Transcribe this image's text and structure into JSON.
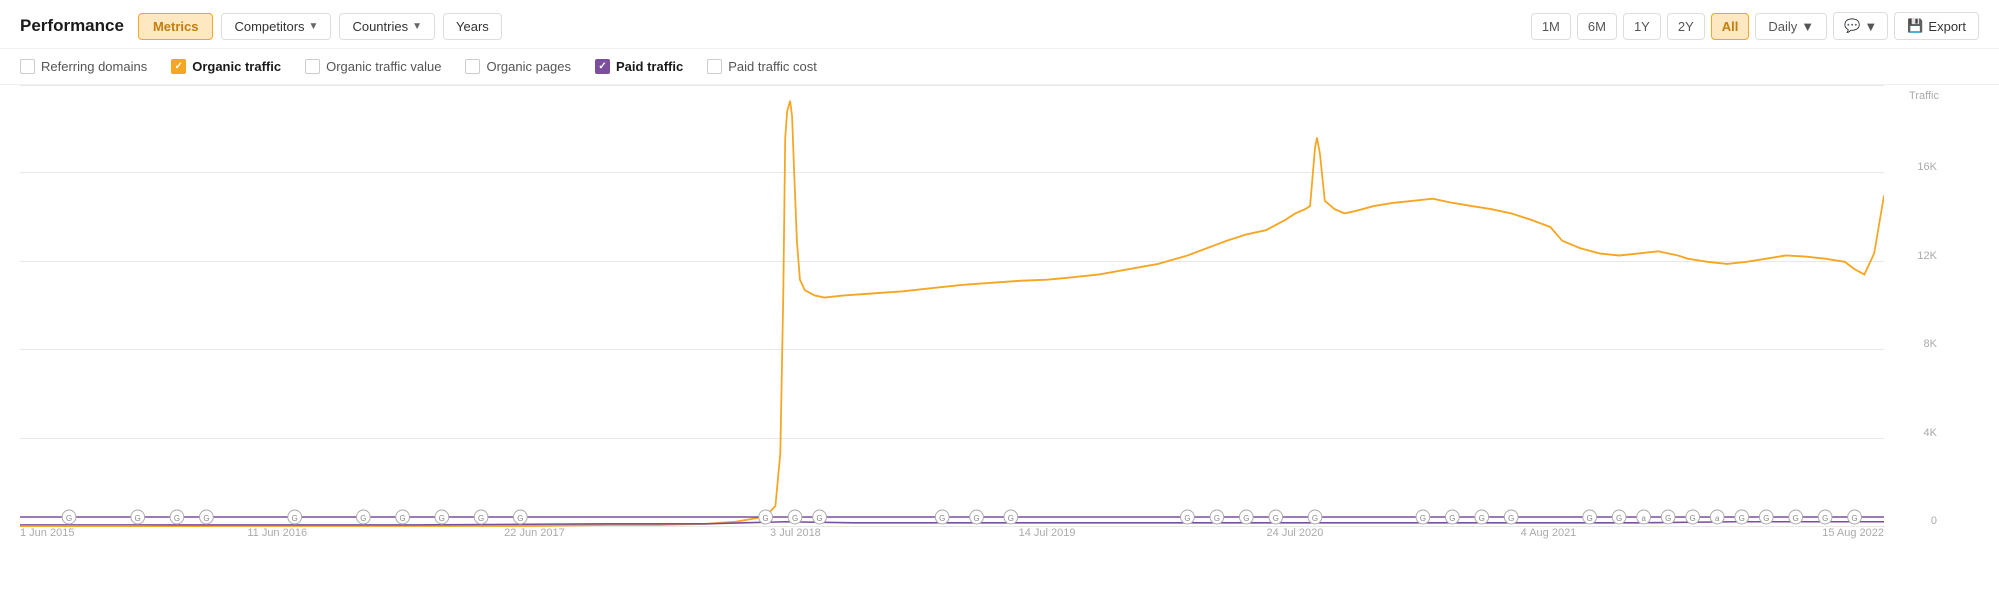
{
  "header": {
    "title": "Performance",
    "buttons": {
      "metrics": "Metrics",
      "competitors": "Competitors",
      "countries": "Countries",
      "years": "Years"
    },
    "time_ranges": [
      "1M",
      "6M",
      "1Y",
      "2Y",
      "All"
    ],
    "active_time_range": "All",
    "interval": "Daily",
    "export_label": "Export"
  },
  "metrics": [
    {
      "id": "referring_domains",
      "label": "Referring domains",
      "checked": false,
      "color": "none"
    },
    {
      "id": "organic_traffic",
      "label": "Organic traffic",
      "checked": true,
      "color": "orange"
    },
    {
      "id": "organic_traffic_value",
      "label": "Organic traffic value",
      "checked": false,
      "color": "none"
    },
    {
      "id": "organic_pages",
      "label": "Organic pages",
      "checked": false,
      "color": "none"
    },
    {
      "id": "paid_traffic",
      "label": "Paid traffic",
      "checked": true,
      "color": "purple"
    },
    {
      "id": "paid_traffic_cost",
      "label": "Paid traffic cost",
      "checked": false,
      "color": "none"
    }
  ],
  "chart": {
    "y_axis_label": "Traffic",
    "y_labels": [
      "0",
      "4K",
      "8K",
      "12K",
      "16K",
      ""
    ],
    "x_labels": [
      "1 Jun 2015",
      "11 Jun 2016",
      "22 Jun 2017",
      "3 Jul 2018",
      "14 Jul 2019",
      "24 Jul 2020",
      "4 Aug 2021",
      "15 Aug 2022"
    ]
  }
}
